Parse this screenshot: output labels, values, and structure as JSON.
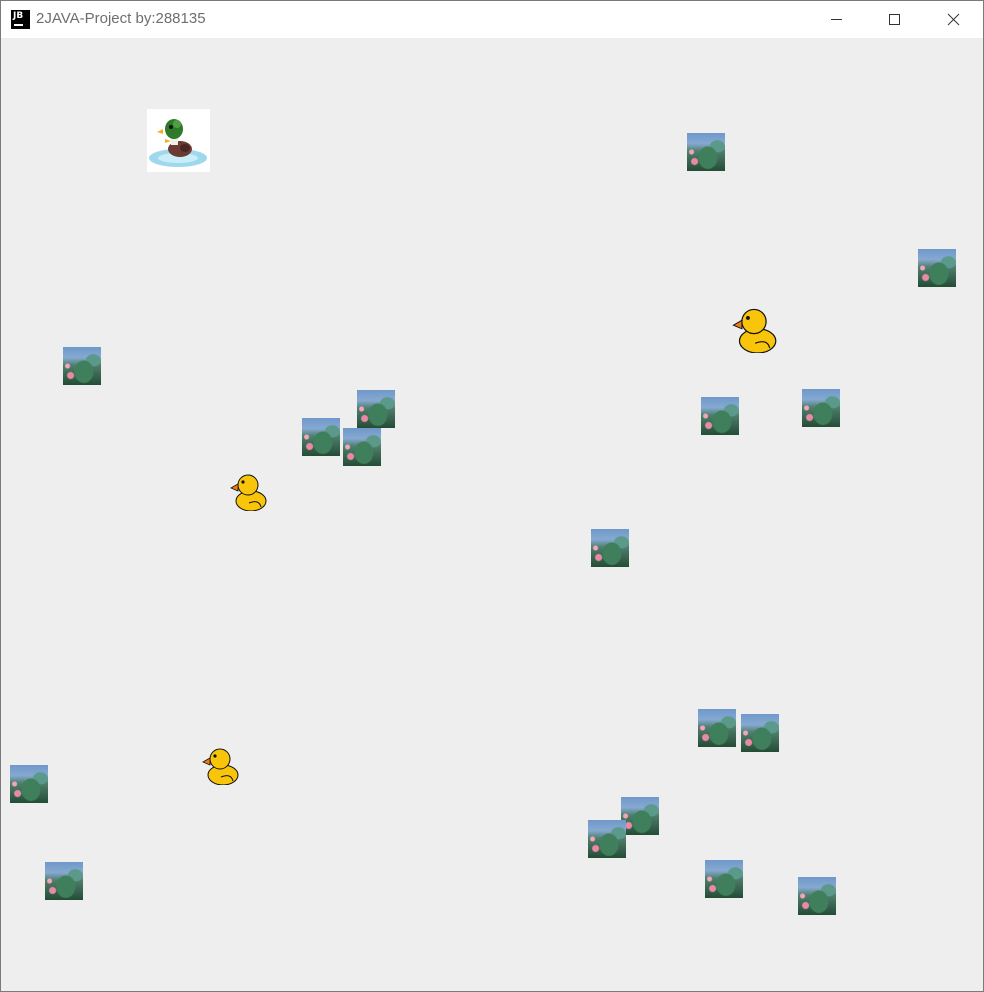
{
  "window": {
    "title": "2JAVA-Project by:288135",
    "app_icon": "jetbrains-logo-icon",
    "controls": [
      "minimize-icon",
      "maximize-icon",
      "close-icon"
    ]
  },
  "game": {
    "background": "#eeeeee",
    "player": "mallard-duck",
    "enemies": "yellow-duck",
    "obstacles": "lotus-leaf-tile"
  }
}
